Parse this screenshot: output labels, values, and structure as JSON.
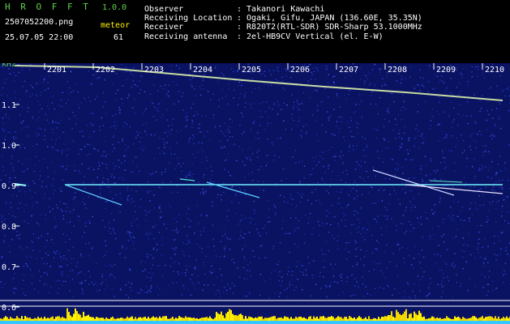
{
  "header": {
    "app_name": "H R O F F T",
    "version": "1.0.0",
    "filename": "2507052200.png",
    "datetime": "25.07.05 22:00",
    "meteor_label": "meteor",
    "meteor_count": "61",
    "fields": [
      {
        "label": "Observer",
        "value": ": Takanori Kawachi"
      },
      {
        "label": "Receiving Location",
        "value": ": Ogaki, Gifu, JAPAN (136.60E, 35.35N)"
      },
      {
        "label": "Receiver",
        "value": ": R820T2(RTL-SDR) SDR-Sharp 53.1000MHz"
      },
      {
        "label": "Receiving antenna",
        "value": ": 2el-HB9CV Vertical (el. E-W)"
      }
    ]
  },
  "plot": {
    "unit": "kHz",
    "time_labels": [
      "2201",
      "2202",
      "2203",
      "2204",
      "2205",
      "2206",
      "2207",
      "2208",
      "2209",
      "2210"
    ],
    "freq_labels": [
      "1.1",
      "1.0",
      "0.9",
      "0.8",
      "0.7",
      "0.6"
    ]
  },
  "colors": {
    "green": "#5fd34a",
    "yellow": "#fff200",
    "cyan": "#6ff0ff",
    "noise_blue": "#1c2c9a"
  }
}
